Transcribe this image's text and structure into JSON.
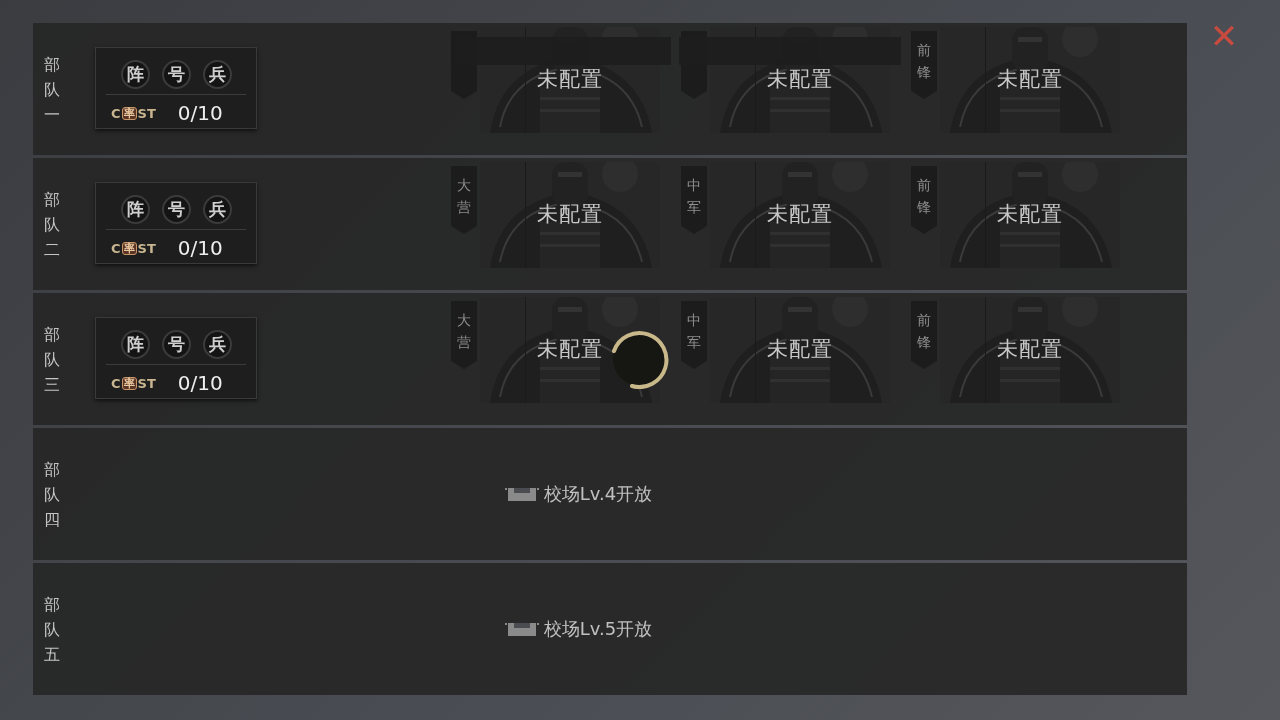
{
  "close_button": {
    "label": "✕"
  },
  "squads": [
    {
      "label": "部队一",
      "kind": "unlocked",
      "redacted": true,
      "formation": {
        "icons": [
          "阵",
          "号",
          "兵"
        ],
        "cost_prefix": "C",
        "cost_seal": "率",
        "cost_suffix": "ST",
        "cost": "0/10"
      },
      "slots": [
        {
          "status": "未配置"
        },
        {
          "status": "未配置"
        },
        {
          "banner": "前锋",
          "status": "未配置"
        }
      ]
    },
    {
      "label": "部队二",
      "kind": "unlocked",
      "formation": {
        "icons": [
          "阵",
          "号",
          "兵"
        ],
        "cost_prefix": "C",
        "cost_seal": "率",
        "cost_suffix": "ST",
        "cost": "0/10"
      },
      "slots": [
        {
          "banner": "大营",
          "status": "未配置"
        },
        {
          "banner": "中军",
          "status": "未配置"
        },
        {
          "banner": "前锋",
          "status": "未配置"
        }
      ]
    },
    {
      "label": "部队三",
      "kind": "unlocked",
      "loading": true,
      "formation": {
        "icons": [
          "阵",
          "号",
          "兵"
        ],
        "cost_prefix": "C",
        "cost_seal": "率",
        "cost_suffix": "ST",
        "cost": "0/10"
      },
      "slots": [
        {
          "banner": "大营",
          "status": "未配置"
        },
        {
          "banner": "中军",
          "status": "未配置"
        },
        {
          "banner": "前锋",
          "status": "未配置"
        }
      ]
    },
    {
      "label": "部队四",
      "kind": "locked",
      "unlock": "校场Lv.4开放"
    },
    {
      "label": "部队五",
      "kind": "locked",
      "unlock": "校场Lv.5开放"
    }
  ]
}
